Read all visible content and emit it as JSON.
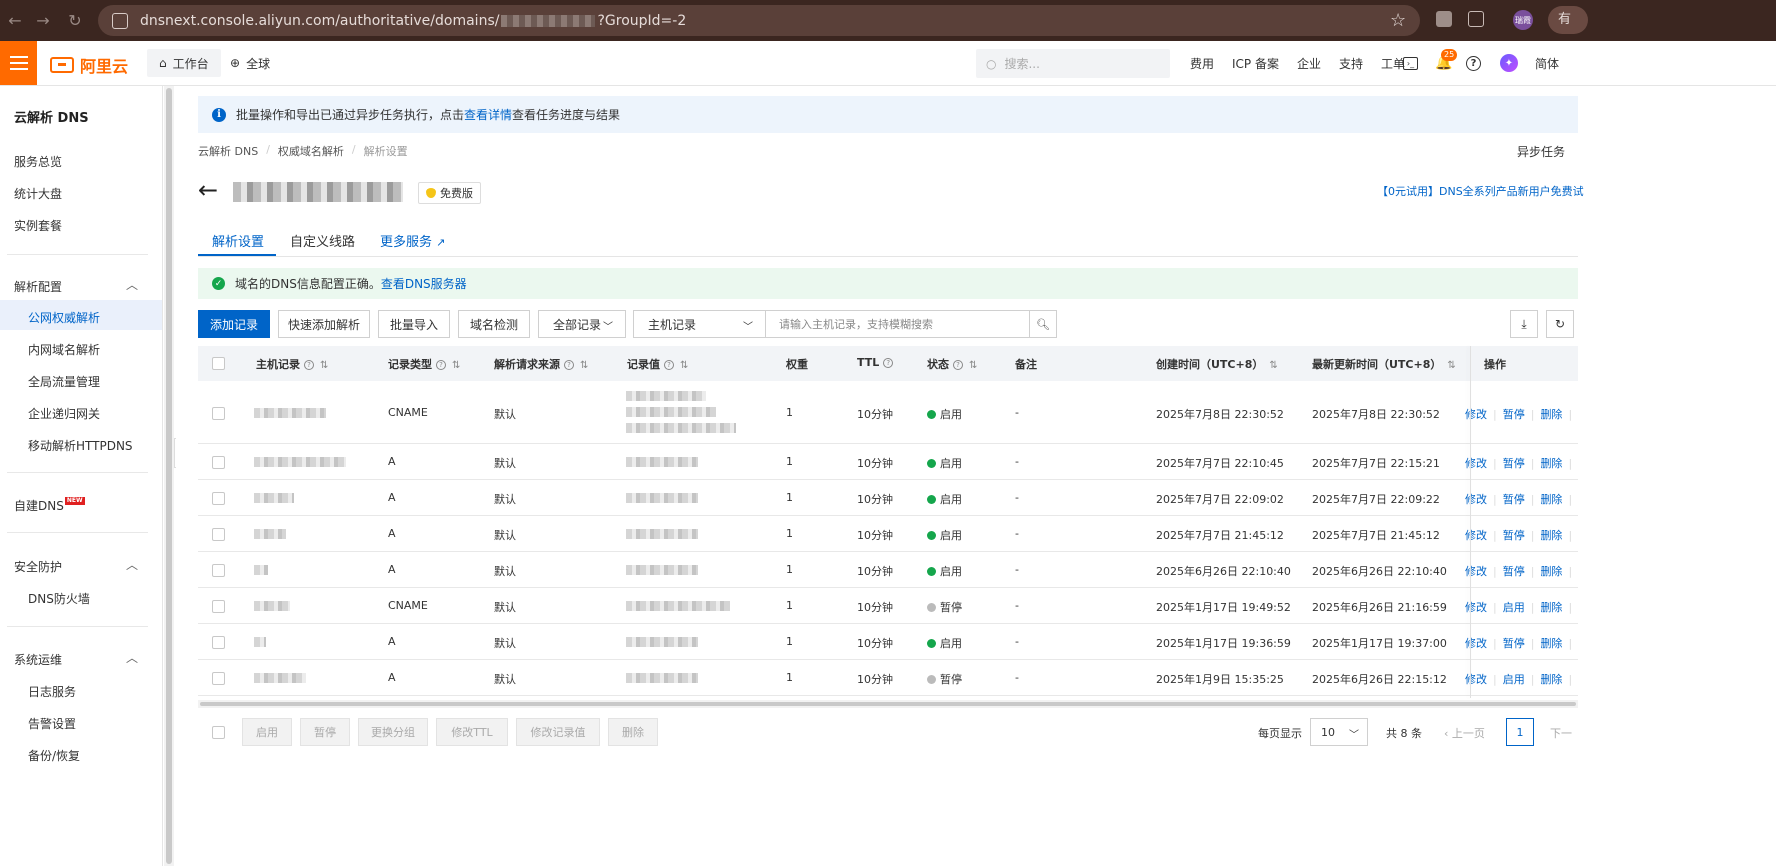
{
  "browser": {
    "url_prefix": "dnsnext.console.aliyun.com/authoritative/domains/",
    "url_suffix": "?GroupId=-2",
    "profile_label": "瑞霞",
    "more_label": "有"
  },
  "topnav": {
    "logo_text": "阿里云",
    "workbench": "工作台",
    "region": "全球",
    "search_placeholder": "搜索...",
    "links": [
      "费用",
      "ICP 备案",
      "企业",
      "支持",
      "工单"
    ],
    "notification_count": "25",
    "lang": "简体"
  },
  "sidebar": {
    "title": "云解析 DNS",
    "top_items": [
      "服务总览",
      "统计大盘",
      "实例套餐"
    ],
    "group_resolve": "解析配置",
    "resolve_items": [
      "公网权威解析",
      "内网域名解析",
      "全局流量管理",
      "企业递归网关",
      "移动解析HTTPDNS"
    ],
    "self_dns": "自建DNS",
    "new_tag": "NEW",
    "group_security": "安全防护",
    "security_items": [
      "DNS防火墙"
    ],
    "group_ops": "系统运维",
    "ops_items": [
      "日志服务",
      "告警设置",
      "备份/恢复"
    ]
  },
  "notice": {
    "text_before": "批量操作和导出已通过异步任务执行，点击",
    "link": "查看详情",
    "text_after": "查看任务进度与结果"
  },
  "breadcrumb": [
    "云解析 DNS",
    "权威域名解析",
    "解析设置"
  ],
  "async_task": "异步任务",
  "edition": "免费版",
  "promo": "【0元试用】DNS全系列产品新用户免费试",
  "tabs": [
    "解析设置",
    "自定义线路",
    "更多服务"
  ],
  "success": {
    "text": "域名的DNS信息配置正确。",
    "link": "查看DNS服务器"
  },
  "toolbar": {
    "add": "添加记录",
    "quick_add": "快速添加解析",
    "batch_import": "批量导入",
    "domain_check": "域名检测",
    "filter_all": "全部记录",
    "filter_field": "主机记录",
    "search_placeholder": "请输入主机记录，支持模糊搜索"
  },
  "table": {
    "headers": {
      "host": "主机记录",
      "type": "记录类型",
      "source": "解析请求来源",
      "value": "记录值",
      "weight": "权重",
      "ttl": "TTL",
      "status": "状态",
      "remark": "备注",
      "created": "创建时间（UTC+8）",
      "updated": "最新更新时间（UTC+8）",
      "ops": "操作"
    },
    "ops_modify": "修改",
    "ops_delete": "删除",
    "rows": [
      {
        "type": "CNAME",
        "source": "默认",
        "weight": "1",
        "ttl": "10分钟",
        "status": "启用",
        "status_on": true,
        "remark": "-",
        "created": "2025年7月8日 22:30:52",
        "updated": "2025年7月8日 22:30:52",
        "toggle": "暂停"
      },
      {
        "type": "A",
        "source": "默认",
        "weight": "1",
        "ttl": "10分钟",
        "status": "启用",
        "status_on": true,
        "remark": "-",
        "created": "2025年7月7日 22:10:45",
        "updated": "2025年7月7日 22:15:21",
        "toggle": "暂停"
      },
      {
        "type": "A",
        "source": "默认",
        "weight": "1",
        "ttl": "10分钟",
        "status": "启用",
        "status_on": true,
        "remark": "-",
        "created": "2025年7月7日 22:09:02",
        "updated": "2025年7月7日 22:09:22",
        "toggle": "暂停"
      },
      {
        "type": "A",
        "source": "默认",
        "weight": "1",
        "ttl": "10分钟",
        "status": "启用",
        "status_on": true,
        "remark": "-",
        "created": "2025年7月7日 21:45:12",
        "updated": "2025年7月7日 21:45:12",
        "toggle": "暂停"
      },
      {
        "type": "A",
        "source": "默认",
        "weight": "1",
        "ttl": "10分钟",
        "status": "启用",
        "status_on": true,
        "remark": "-",
        "created": "2025年6月26日 22:10:40",
        "updated": "2025年6月26日 22:10:40",
        "toggle": "暂停"
      },
      {
        "type": "CNAME",
        "source": "默认",
        "weight": "1",
        "ttl": "10分钟",
        "status": "暂停",
        "status_on": false,
        "remark": "-",
        "created": "2025年1月17日 19:49:52",
        "updated": "2025年6月26日 21:16:59",
        "toggle": "启用"
      },
      {
        "type": "A",
        "source": "默认",
        "weight": "1",
        "ttl": "10分钟",
        "status": "启用",
        "status_on": true,
        "remark": "-",
        "created": "2025年1月17日 19:36:59",
        "updated": "2025年1月17日 19:37:00",
        "toggle": "暂停"
      },
      {
        "type": "A",
        "source": "默认",
        "weight": "1",
        "ttl": "10分钟",
        "status": "暂停",
        "status_on": false,
        "remark": "-",
        "created": "2025年1月9日 15:35:25",
        "updated": "2025年6月26日 22:15:12",
        "toggle": "启用"
      }
    ]
  },
  "footer": {
    "batch_buttons": [
      "启用",
      "暂停",
      "更换分组",
      "修改TTL",
      "修改记录值",
      "删除"
    ],
    "page_size_label": "每页显示",
    "page_size": "10",
    "total": "共 8 条",
    "prev": "上一页",
    "current_page": "1",
    "next": "下一"
  },
  "colors": {
    "brand": "#ff6a00",
    "primary": "#0064c8",
    "success": "#15a64c"
  }
}
